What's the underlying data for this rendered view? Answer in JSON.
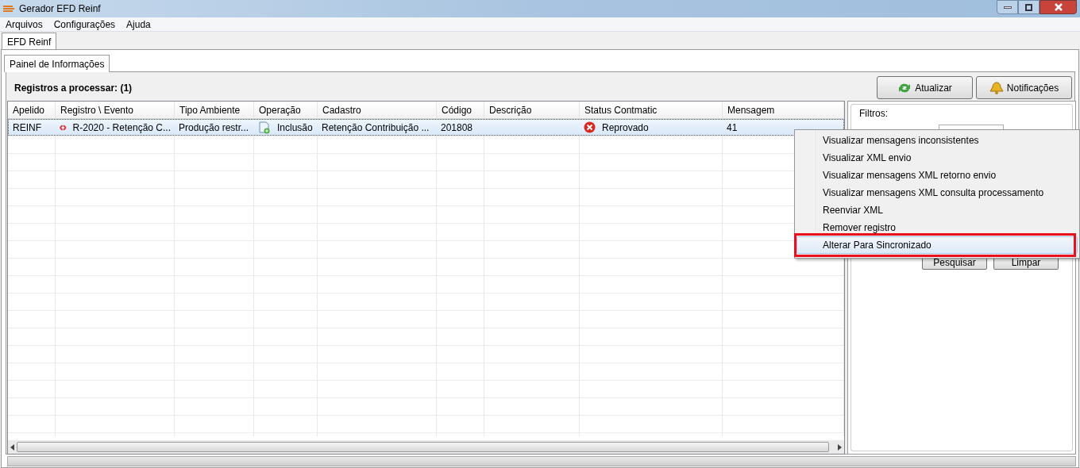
{
  "window": {
    "title": "Gerador EFD Reinf"
  },
  "menu_bar": [
    {
      "label": "Arquivos"
    },
    {
      "label": "Configurações"
    },
    {
      "label": "Ajuda"
    }
  ],
  "tabs": [
    {
      "label": "EFD Reinf",
      "selected": true
    }
  ],
  "inner_tabs": [
    {
      "label": "Painel de Informações",
      "selected": true
    }
  ],
  "heading": "Registros a processar: (1)",
  "toolbar_buttons": [
    {
      "label": "Atualizar",
      "kind": "refresh"
    },
    {
      "label": "Notificações",
      "kind": "bell"
    }
  ],
  "table": {
    "columns": [
      "Apelido",
      "Registro \\ Evento",
      "Tipo Ambiente",
      "Operação",
      "Cadastro",
      "Código",
      "Descrição",
      "Status Contmatic",
      "Mensagem"
    ],
    "rows": [
      {
        "selected": true,
        "cells": [
          "REINF",
          "R-2020 - Retenção C...",
          "Produção restr...",
          "Inclusão",
          "Retenção Contribuição ...",
          "201808",
          "",
          "Reprovado",
          "41"
        ]
      }
    ]
  },
  "filters": {
    "title": "Filtros:",
    "buttons": [
      "Pesquisar",
      "Limpar"
    ]
  },
  "context_menu": [
    {
      "label": "Visualizar mensagens inconsistentes",
      "selected": false
    },
    {
      "label": "Visualizar XML envio",
      "selected": false
    },
    {
      "label": "Visualizar mensagens XML retorno envio",
      "selected": false
    },
    {
      "label": "Visualizar mensagens XML consulta processamento",
      "selected": false
    },
    {
      "label": "Reenviar XML",
      "selected": false
    },
    {
      "label": "Remover registro",
      "selected": false
    },
    {
      "label": "Alterar Para Sincronizado",
      "selected": true
    }
  ]
}
